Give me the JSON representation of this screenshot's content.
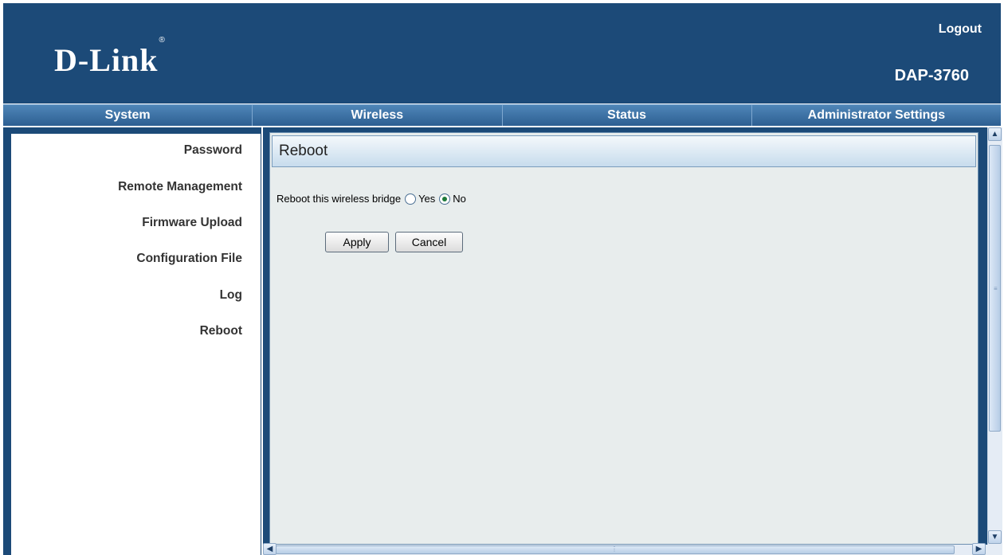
{
  "header": {
    "logo": "D-Link",
    "logo_mark": "®",
    "logout": "Logout",
    "model": "DAP-3760"
  },
  "nav": {
    "tabs": [
      "System",
      "Wireless",
      "Status",
      "Administrator Settings"
    ]
  },
  "sidebar": {
    "items": [
      "Password",
      "Remote Management",
      "Firmware Upload",
      "Configuration File",
      "Log",
      "Reboot"
    ]
  },
  "main": {
    "title": "Reboot",
    "reboot_label": "Reboot this wireless bridge",
    "option_yes": "Yes",
    "option_no": "No",
    "selected": "No",
    "apply_label": "Apply",
    "cancel_label": "Cancel"
  },
  "colors": {
    "header_bg": "#1c4a78",
    "content_bg": "#e8eded",
    "radio_check": "#1d7a3a"
  }
}
